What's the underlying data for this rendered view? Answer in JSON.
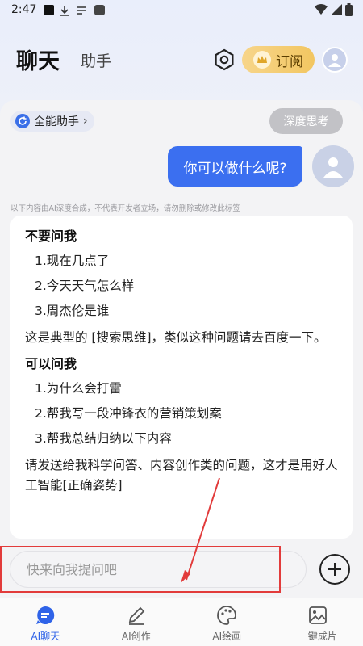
{
  "status_bar": {
    "time": "2:47"
  },
  "header": {
    "tab_chat": "聊天",
    "tab_assistant": "助手",
    "subscribe_label": "订阅"
  },
  "chat": {
    "assistant_chip": "全能助手",
    "deep_think": "深度思考",
    "user_message": "你可以做什么呢?",
    "disclaimer": "以下内容由AI深度合成，不代表开发者立场，请勿删除或修改此标签",
    "answer": {
      "section1_title": "不要问我",
      "section1_items": [
        "1.现在几点了",
        "2.今天天气怎么样",
        "3.周杰伦是谁"
      ],
      "para1": "这是典型的 [搜索思维]，类似这种问题请去百度一下。",
      "section2_title": "可以问我",
      "section2_items": [
        "1.为什么会打雷",
        "2.帮我写一段冲锋衣的营销策划案",
        "3.帮我总结归纳以下内容"
      ],
      "para2": "请发送给我科学问答、内容创作类的问题，这才是用好人工智能[正确姿势]"
    }
  },
  "input": {
    "placeholder": "快来向我提问吧",
    "value": ""
  },
  "bottom_nav": [
    {
      "label": "AI聊天",
      "icon": "chat-icon",
      "active": true
    },
    {
      "label": "AI创作",
      "icon": "pen-icon",
      "active": false
    },
    {
      "label": "AI绘画",
      "icon": "palette-icon",
      "active": false
    },
    {
      "label": "一键成片",
      "icon": "image-icon",
      "active": false
    }
  ],
  "colors": {
    "accent": "#3b6ff0",
    "subscribe": "#f2c661",
    "highlight": "#e23b3b"
  }
}
